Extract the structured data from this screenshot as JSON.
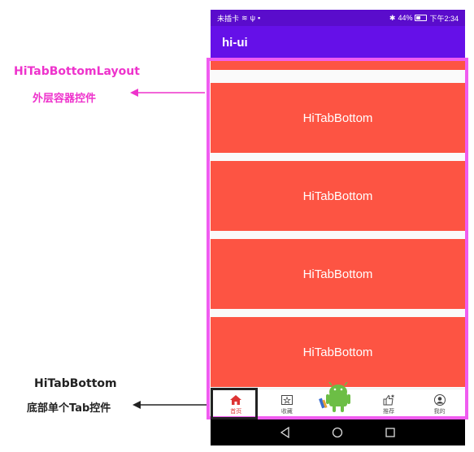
{
  "annotations": {
    "top_title": "HiTabBottomLayout",
    "top_subtitle": "外层容器控件",
    "bottom_title": "HiTabBottom",
    "bottom_subtitle": "底部单个Tab控件"
  },
  "status_bar": {
    "left_text": "未插卡",
    "battery": "44%",
    "time": "下午2:34"
  },
  "app_bar": {
    "title": "hi-ui"
  },
  "tiles": [
    "HiTabBottom",
    "HiTabBottom",
    "HiTabBottom",
    "HiTabBottom"
  ],
  "tabs": [
    {
      "label": "首页",
      "icon": "home-icon",
      "active": true
    },
    {
      "label": "收藏",
      "icon": "favorite-icon",
      "active": false
    },
    {
      "label": "",
      "icon": "android-icon",
      "active": false
    },
    {
      "label": "推荐",
      "icon": "thumbs-up-icon",
      "active": false
    },
    {
      "label": "我的",
      "icon": "profile-icon",
      "active": false
    }
  ],
  "colors": {
    "status_bar": "#5a0ccc",
    "app_bar": "#6510e8",
    "tile": "#fd5443",
    "highlight_frame": "#f05cf0",
    "active_tab": "#d33333"
  }
}
